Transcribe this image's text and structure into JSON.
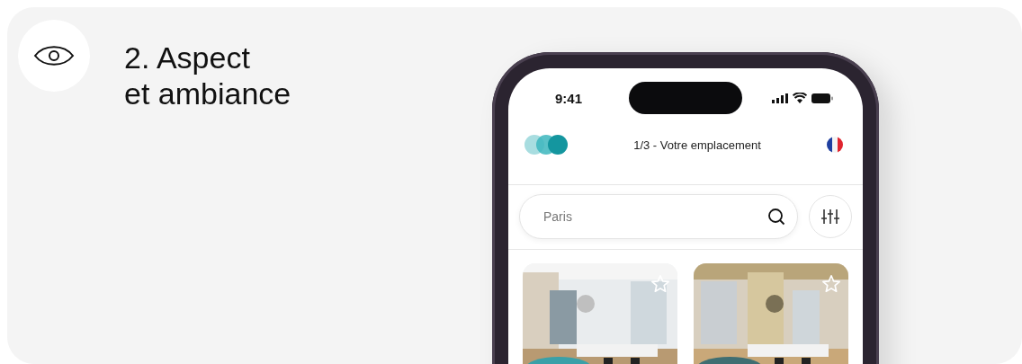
{
  "section": {
    "title_lines": [
      "2. Aspect",
      "et ambiance"
    ]
  },
  "phone": {
    "status_time": "9:41",
    "header_title": "1/3 - Votre emplacement",
    "search": {
      "placeholder": "Paris"
    }
  }
}
